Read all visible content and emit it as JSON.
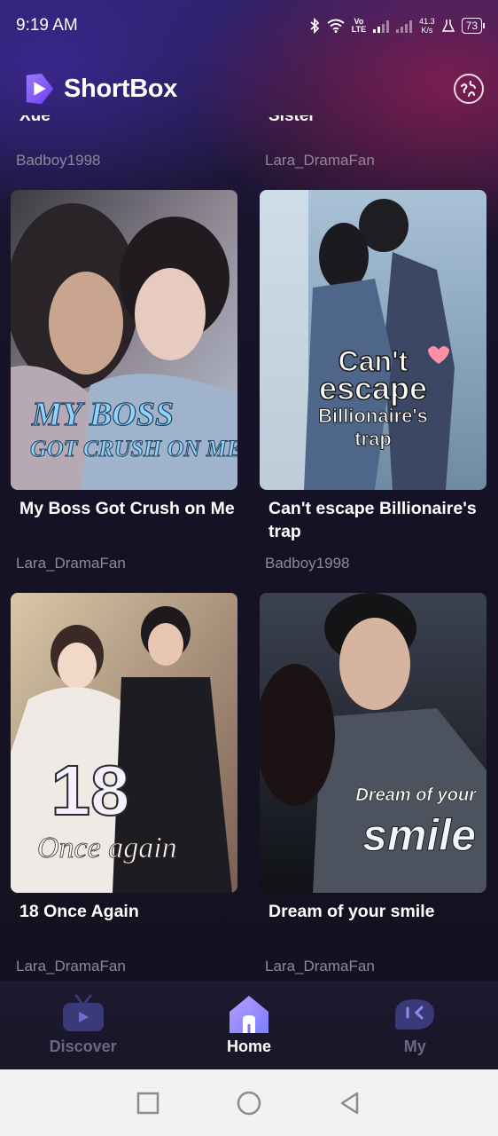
{
  "status_bar": {
    "time": "9:19 AM",
    "volte_top": "Vo",
    "volte_bottom": "LTE",
    "net_speed_value": "41.3",
    "net_speed_unit": "K/s",
    "battery": "73"
  },
  "header": {
    "app_name": "ShortBox"
  },
  "top_row": {
    "left": {
      "title_fragment": "Xue",
      "author": "Badboy1998"
    },
    "right": {
      "title_fragment": "Sister",
      "author": "Lara_DramaFan"
    }
  },
  "dramas": [
    {
      "title": "My Boss Got Crush on Me",
      "author": "Lara_DramaFan",
      "poster_text": [
        "MY BOSS",
        "GOT CRUSH ON ME"
      ]
    },
    {
      "title": "Can't escape Billionaire's trap",
      "author": "Badboy1998",
      "poster_text": [
        "Can't",
        "escape",
        "Billionaire's",
        "trap"
      ]
    },
    {
      "title": "18 Once Again",
      "author": "Lara_DramaFan",
      "poster_text": [
        "18",
        "Once again"
      ]
    },
    {
      "title": "Dream of your smile",
      "author": "Lara_DramaFan",
      "poster_text": [
        "Dream of your",
        "smile"
      ]
    }
  ],
  "bottom_nav": [
    {
      "label": "Discover",
      "icon": "tv-icon",
      "active": false
    },
    {
      "label": "Home",
      "icon": "home-icon",
      "active": true
    },
    {
      "label": "My",
      "icon": "profile-icon",
      "active": false
    }
  ],
  "colors": {
    "accent_purple": "#7b5cff",
    "author_gray": "#8c8a97",
    "nav_inactive": "#6d6880"
  }
}
